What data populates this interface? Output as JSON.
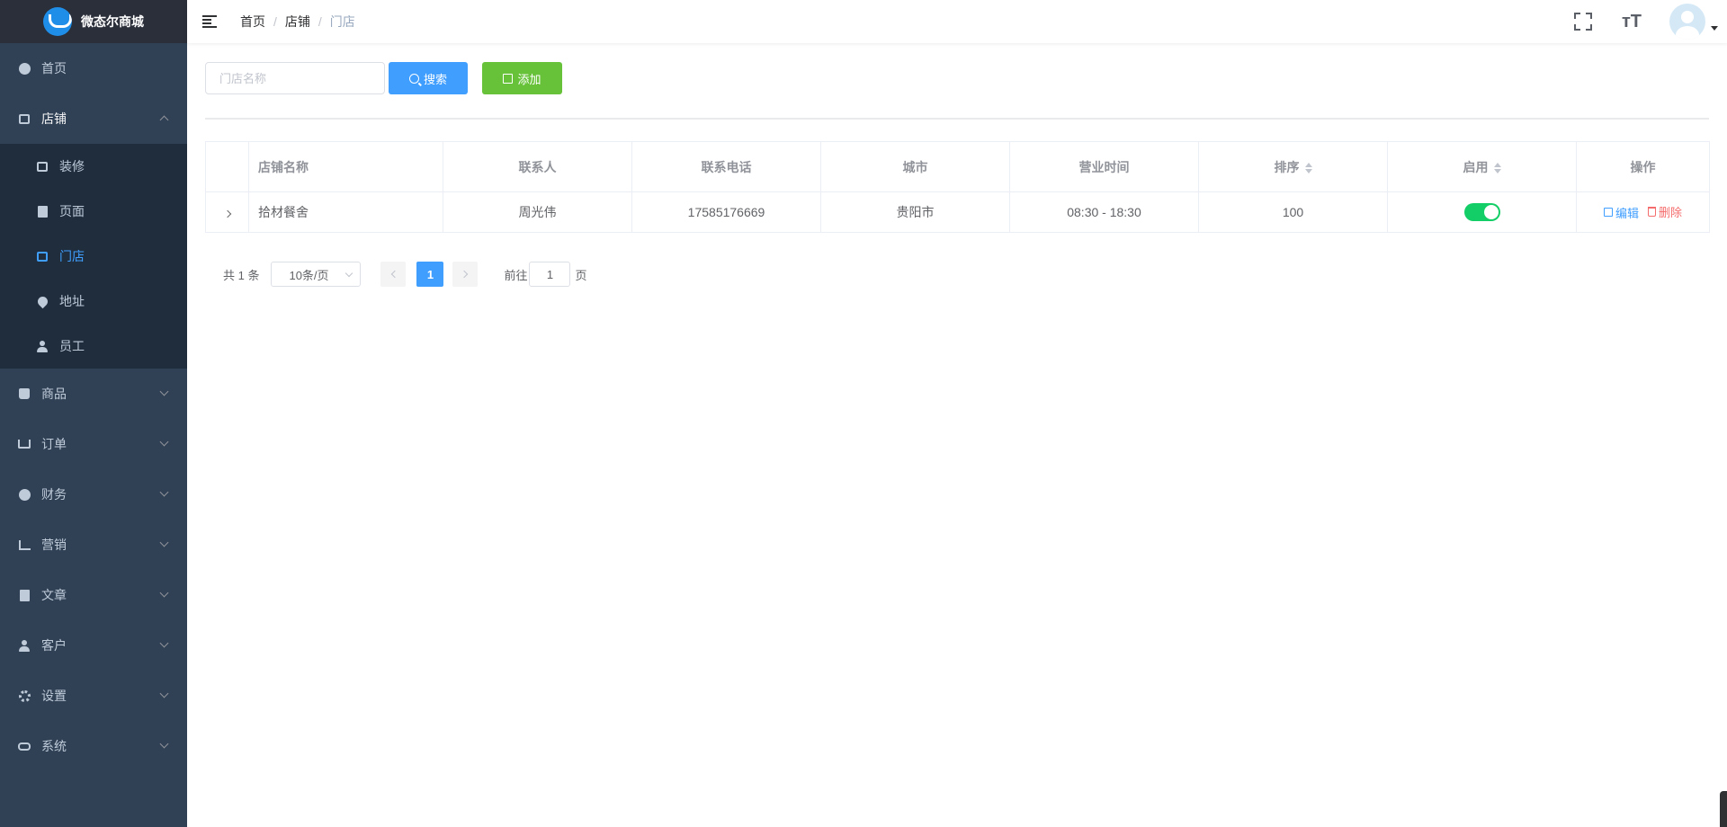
{
  "app": {
    "title": "微态尔商城"
  },
  "sidebar": {
    "items": [
      {
        "label": "首页",
        "icon": "dashboard-icon"
      },
      {
        "label": "店铺",
        "icon": "shop-icon",
        "open": true,
        "children": [
          {
            "label": "装修",
            "icon": "layout-icon"
          },
          {
            "label": "页面",
            "icon": "document-icon"
          },
          {
            "label": "门店",
            "icon": "store-icon",
            "active": true
          },
          {
            "label": "地址",
            "icon": "location-icon"
          },
          {
            "label": "员工",
            "icon": "user-icon"
          }
        ]
      },
      {
        "label": "商品",
        "icon": "bag-icon"
      },
      {
        "label": "订单",
        "icon": "cart-icon"
      },
      {
        "label": "财务",
        "icon": "yen-icon"
      },
      {
        "label": "营销",
        "icon": "chart-icon"
      },
      {
        "label": "文章",
        "icon": "article-icon"
      },
      {
        "label": "客户",
        "icon": "customer-icon"
      },
      {
        "label": "设置",
        "icon": "gear-icon"
      },
      {
        "label": "系统",
        "icon": "link-icon"
      }
    ]
  },
  "header": {
    "breadcrumb": [
      "首页",
      "店铺",
      "门店"
    ],
    "font_size_icon_text": "тT"
  },
  "toolbar": {
    "search_placeholder": "门店名称",
    "search_value": "",
    "search_label": "搜索",
    "add_label": "添加"
  },
  "table": {
    "columns": [
      "",
      "店铺名称",
      "联系人",
      "联系电话",
      "城市",
      "营业时间",
      "排序",
      "启用",
      "操作"
    ],
    "rows": [
      {
        "name": "拾材餐舍",
        "contact": "周光伟",
        "phone": "17585176669",
        "city": "贵阳市",
        "hours": "08:30 - 18:30",
        "sort": "100",
        "enabled": true
      }
    ],
    "edit_label": "编辑",
    "delete_label": "删除"
  },
  "pagination": {
    "total_text": "共 1 条",
    "page_size": "10条/页",
    "current_page": "1",
    "goto_prefix": "前往",
    "goto_value": "1",
    "goto_suffix": "页"
  },
  "colors": {
    "sidebar_bg": "#304156",
    "primary": "#409eff",
    "success": "#67c23a",
    "switch_on": "#13ce66",
    "danger": "#f56c6c"
  }
}
